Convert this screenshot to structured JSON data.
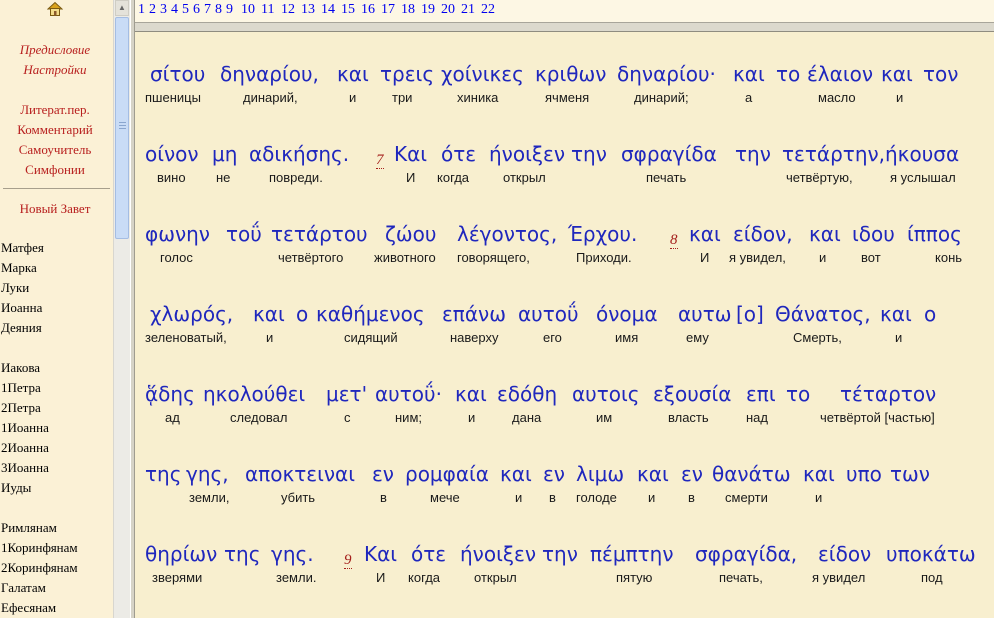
{
  "sidebar": {
    "home_icon": "home-icon",
    "links_top": [
      "Предисловие",
      "Настройки"
    ],
    "links_mid": [
      "Литерат.пер.",
      "Комментарий",
      "Самоучитель",
      "Симфонии"
    ],
    "section_title": "Новый Завет",
    "books_group1": [
      "Матфея",
      "Марка",
      "Луки",
      "Иоанна",
      "Деяния"
    ],
    "books_group2": [
      "Иакова",
      "1Петра",
      "2Петра",
      "1Иоанна",
      "2Иоанна",
      "3Иоанна",
      "Иуды"
    ],
    "books_group3": [
      "Римлянам",
      "1Коринфянам",
      "2Коринфянам",
      "Галатам",
      "Ефесянам"
    ]
  },
  "chapters": [
    "1",
    "2",
    "3",
    "4",
    "5",
    "6",
    "7",
    "8",
    "9",
    "10",
    "11",
    "12",
    "13",
    "14",
    "15",
    "16",
    "17",
    "18",
    "19",
    "20",
    "21",
    "22"
  ],
  "colors": {
    "sidebar_bg": "#fbf1d6",
    "content_bg": "#f8efcf",
    "greek_text": "#1f27bd",
    "link": "#0000ee",
    "sidebar_link": "#b8201f",
    "verse_number": "#a5201c"
  },
  "lines": [
    {
      "greek": [
        "σίτου",
        "δηναρίου,",
        "και",
        "τρεις",
        "χοίνικες",
        "κριθων",
        "δηναρίου·",
        "και",
        "το",
        "έλαιον",
        "και",
        "τον"
      ],
      "russian": [
        "пшеницы",
        "динарий,",
        "и",
        "три",
        "хиника",
        "ячменя",
        "динарий;",
        "а",
        "масло",
        "и"
      ]
    },
    {
      "greek": [
        "οίνον",
        "μη",
        "αδικήσης.",
        "Και",
        "ότε",
        "ήνοιξεν",
        "την",
        "σφραγίδα",
        "την",
        "τετάρτην,",
        "ήκουσα"
      ],
      "verse": "7",
      "russian": [
        "вино",
        "не",
        "повреди.",
        "И",
        "когда",
        "открыл",
        "печать",
        "четвёртую,",
        "я услышал"
      ]
    },
    {
      "greek": [
        "φωνην",
        "τοΰ",
        "τετάρτου",
        "ζώου",
        "λέγοντος,",
        "Έρχου.",
        "και",
        "είδον,",
        "και",
        "ιδου",
        "ίππος"
      ],
      "verse": "8",
      "russian": [
        "голос",
        "четвёртого",
        "животного",
        "говорящего,",
        "Приходи.",
        "И",
        "я увидел,",
        "и",
        "вот",
        "конь"
      ]
    },
    {
      "greek": [
        "χλωρός,",
        "και",
        "ο",
        "καθήμενος",
        "επάνω",
        "αυτοΰ",
        "όνομα",
        "αυτω",
        "[ο]",
        "Θάνατος,",
        "και",
        "ο"
      ],
      "russian": [
        "зеленоватый,",
        "и",
        "сидящий",
        "наверху",
        "его",
        "имя",
        "ему",
        "Смерть,",
        "и"
      ]
    },
    {
      "greek": [
        "ᾅδης",
        "ηκολούθει",
        "μετ'",
        "αυτοΰ·",
        "και",
        "εδόθη",
        "αυτοις",
        "εξουσία",
        "επι",
        "το",
        "τέταρτον"
      ],
      "russian": [
        "ад",
        "следовал",
        "с",
        "ним;",
        "и",
        "дана",
        "им",
        "власть",
        "над",
        "четвёртой [частью]"
      ]
    },
    {
      "greek": [
        "της",
        "γης,",
        "αποκτειναι",
        "εν",
        "ρομφαία",
        "και",
        "εν",
        "λιμω",
        "και",
        "εν",
        "θανάτω",
        "και",
        "υπο",
        "των"
      ],
      "russian": [
        "земли,",
        "убить",
        "в",
        "мече",
        "и",
        "в",
        "голоде",
        "и",
        "в",
        "смерти",
        "и"
      ]
    },
    {
      "greek": [
        "θηρίων",
        "της",
        "γης.",
        "Και",
        "ότε",
        "ήνοιξεν",
        "την",
        "πέμπτην",
        "σφραγίδα,",
        "είδον",
        "υποκάτω"
      ],
      "verse": "9",
      "russian": [
        "зверями",
        "земли.",
        "И",
        "когда",
        "открыл",
        "пятую",
        "печать,",
        "я увидел",
        "под"
      ]
    }
  ]
}
